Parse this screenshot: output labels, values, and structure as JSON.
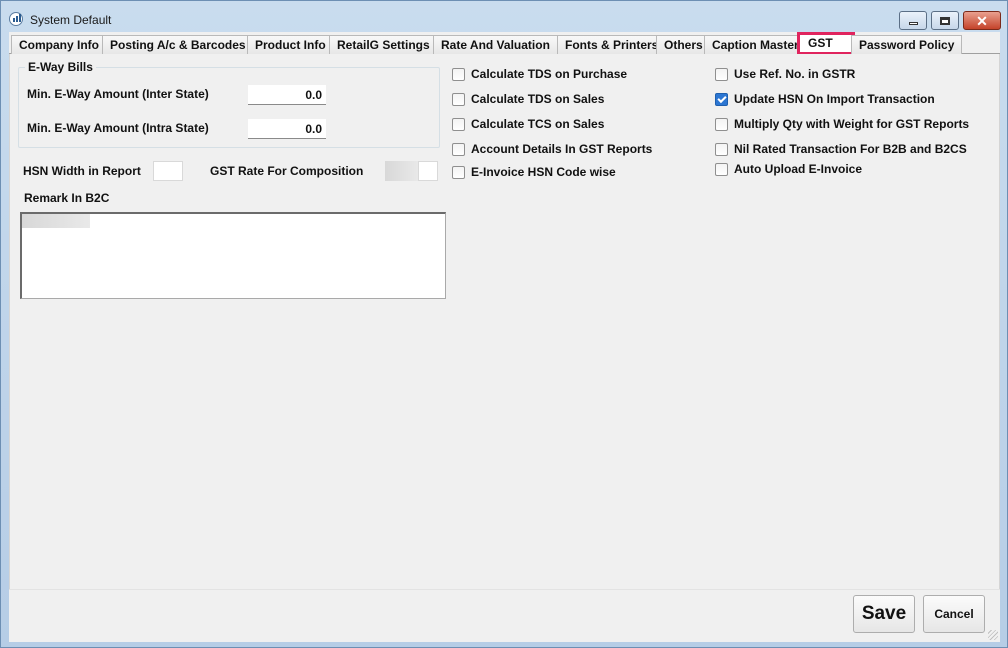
{
  "window": {
    "title": "System Default",
    "icon": "app-chart-icon"
  },
  "title_controls": {
    "minimize_icon": "minimize-icon",
    "maximize_icon": "maximize-icon",
    "close_icon": "close-icon",
    "close_glyph": "✕"
  },
  "tabs": [
    {
      "label": "Company Info"
    },
    {
      "label": "Posting A/c & Barcodes"
    },
    {
      "label": "Product Info"
    },
    {
      "label": "RetailG Settings"
    },
    {
      "label": "Rate And Valuation"
    },
    {
      "label": "Fonts & Printers"
    },
    {
      "label": "Others"
    },
    {
      "label": "Caption Master"
    },
    {
      "label": "GST"
    },
    {
      "label": "Password Policy"
    }
  ],
  "active_tab": "GST",
  "accent_color": "#e0245e",
  "eway": {
    "title": "E-Way Bills",
    "inter_label": "Min. E-Way Amount (Inter State)",
    "inter_value": "0.0",
    "intra_label": "Min. E-Way Amount (Intra State)",
    "intra_value": "0.0"
  },
  "hsn": {
    "width_label": "HSN Width in Report",
    "gst_rate_label": "GST Rate For Composition",
    "remark_label": "Remark In B2C"
  },
  "checkboxes_mid": [
    {
      "label": "Calculate TDS on Purchase",
      "checked": false
    },
    {
      "label": "Calculate TDS on Sales",
      "checked": false
    },
    {
      "label": "Calculate TCS on Sales",
      "checked": false
    },
    {
      "label": "Account Details In GST Reports",
      "checked": false
    },
    {
      "label": "E-Invoice HSN Code wise",
      "checked": false
    }
  ],
  "checkboxes_right": [
    {
      "label": "Use Ref. No. in GSTR",
      "checked": false
    },
    {
      "label": "Update HSN On Import Transaction",
      "checked": true
    },
    {
      "label": "Multiply Qty with Weight for GST Reports",
      "checked": false
    },
    {
      "label": "Nil Rated Transaction For B2B and B2CS",
      "checked": false
    },
    {
      "label": "Auto Upload E-Invoice",
      "checked": false
    }
  ],
  "buttons": {
    "save": "Save",
    "cancel": "Cancel"
  }
}
